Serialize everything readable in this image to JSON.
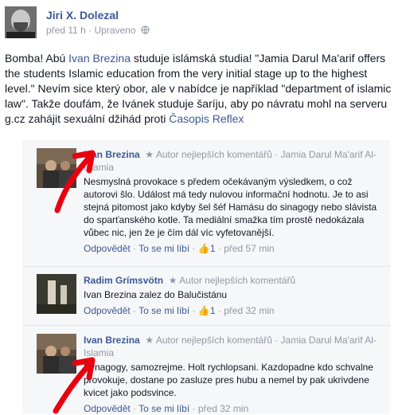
{
  "post": {
    "author": "Jiri X. Dolezal",
    "meta": "před 11 h · Upraveno",
    "text_a": "Bomba! Abú ",
    "text_link1": "Ivan Brezina",
    "text_b": " studuje islámská studia! \"Jamia Darul Ma'arif offers the students Islamic education from the very initial stage up to the highest level.\" Nevím sice který obor, ale v nabídce je například \"department of islamic law\". Takže doufám, že Ivánek studuje šaríju, aby po návratu mohl na serveru g.cz zahájit sexuální džihád proti ",
    "text_link2": "Časopis Reflex"
  },
  "comments": [
    {
      "name": "Ivan Brezina",
      "badge": "Autor nejlepších komentářů · Jamia Darul Ma'arif Al-Islamia",
      "text": "Nesmyslná provokace s předem očekávaným výsledkem, o což autorovi šlo. Událost má tedy nulovou informační hodnotu. Je to asi stejná pitomost jako kdyby šel šéf Hamásu do sinagogy nebo slávista do sparťanského kotle. Ta mediální smažka tím prostě nedokázala vůbec nic, jen že je čím dál víc vyfetovanější.",
      "reply": "Odpovědět",
      "like": "To se mi líbí",
      "likes": "1",
      "time": "před 57 min"
    },
    {
      "name": "Radim Grímsvötn",
      "badge": "Autor nejlepších komentářů",
      "text": "Ivan Brezina zalez do Balučistánu",
      "reply": "Odpovědět",
      "like": "To se mi líbí",
      "likes": "1",
      "time": "před 32 min"
    },
    {
      "name": "Ivan Brezina",
      "badge": "Autor nejlepších komentářů · Jamia Darul Ma'arif Al-Islamia",
      "text": "Synagogy, samozrejme. Holt rychlopsani. Kazdopadne kdo schvalne provokuje, dostane po zasluze pres hubu a nemel by pak ukrivdene kvicet jako podsvince.",
      "reply": "Odpovědět",
      "like": "To se mi líbí",
      "time": "před 32 min"
    }
  ],
  "colors": {
    "link": "#3b5998",
    "meta": "#9197a3",
    "panel": "#f6f7f9",
    "arrow": "#e8000f"
  },
  "icons": [
    "globe-icon",
    "star-icon",
    "thumbs-up-icon"
  ]
}
